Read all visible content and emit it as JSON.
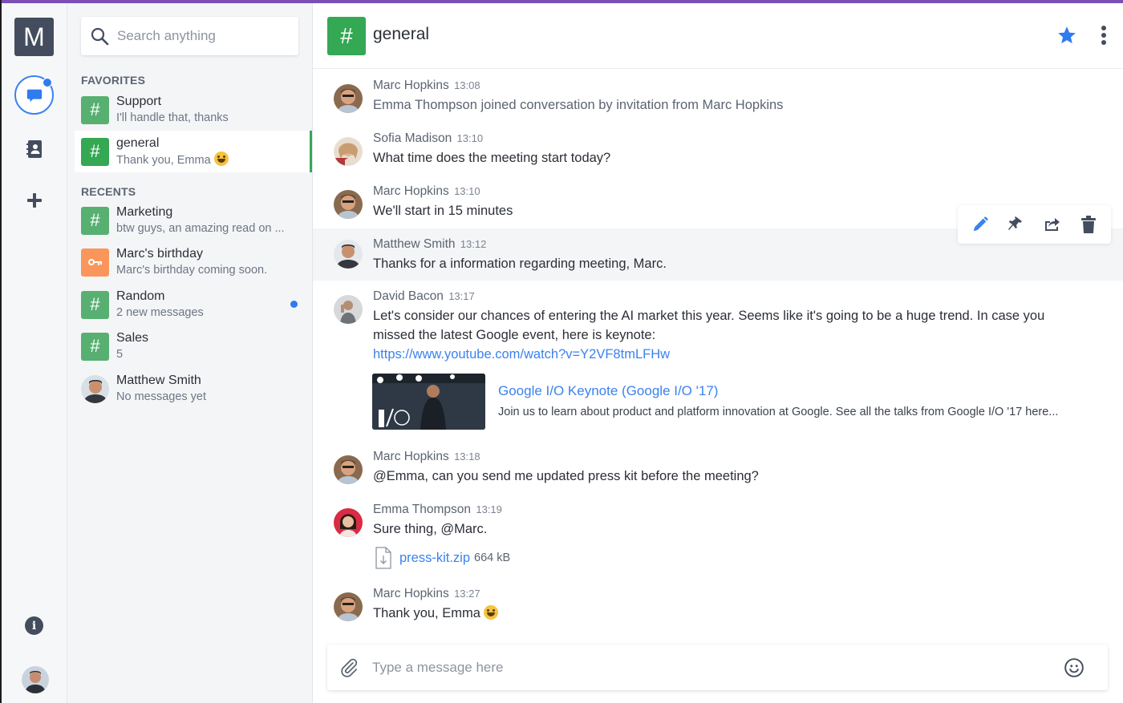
{
  "app": {
    "logo_letter": "M",
    "accent_color": "#3a82ef",
    "channel_color": "#34a853"
  },
  "rail": {
    "items": [
      {
        "name": "chats",
        "icon": "chat-bubble-icon",
        "has_notification": true
      },
      {
        "name": "contacts",
        "icon": "address-book-icon"
      },
      {
        "name": "new",
        "icon": "plus-icon"
      },
      {
        "name": "info",
        "icon": "info-icon",
        "glyph": "i"
      },
      {
        "name": "profile",
        "icon": "user-avatar"
      }
    ]
  },
  "sidebar": {
    "search_placeholder": "Search anything",
    "favorites_label": "FAVORITES",
    "recents_label": "RECENTS",
    "favorites": [
      {
        "name": "Support",
        "preview": "I'll handle that, thanks",
        "icon": "#"
      },
      {
        "name": "general",
        "preview": "Thank you, Emma",
        "icon": "#",
        "active": true,
        "emoji": "smile"
      }
    ],
    "recents": [
      {
        "name": "Marketing",
        "preview": "btw guys, an amazing read on ...",
        "icon": "#"
      },
      {
        "name": "Marc's birthday",
        "preview": "Marc's birthday coming soon.",
        "icon": "key"
      },
      {
        "name": "Random",
        "preview": "2 new messages",
        "icon": "#",
        "unread": true
      },
      {
        "name": "Sales",
        "preview": "5",
        "icon": "#"
      },
      {
        "name": "Matthew Smith",
        "preview": "No messages yet",
        "icon": "avatar"
      }
    ]
  },
  "header": {
    "icon": "#",
    "title": "general",
    "starred": true
  },
  "messages": [
    {
      "author": "Marc Hopkins",
      "time": "13:08",
      "text": "Emma Thompson joined conversation by invitation from Marc Hopkins",
      "system": true
    },
    {
      "author": "Sofia Madison",
      "time": "13:10",
      "text": "What time does the meeting start today?"
    },
    {
      "author": "Marc Hopkins",
      "time": "13:10",
      "text": "We'll start in 15 minutes"
    },
    {
      "author": "Matthew Smith",
      "time": "13:12",
      "text": "Thanks for a information regarding meeting, Marc.",
      "hovered": true
    },
    {
      "author": "David Bacon",
      "time": "13:17",
      "text_line1": "Let's consider our chances of entering the AI market this year. Seems like it's going to be a huge trend. In case you",
      "text_line2": "missed the latest Google event, here is keynote:",
      "link": "https://www.youtube.com/watch?v=Y2VF8tmLFHw",
      "preview": {
        "title": "Google I/O Keynote (Google I/O '17)",
        "description": "Join us to learn about product and platform innovation at Google. See all the talks from Google I/O '17 here..."
      }
    },
    {
      "author": "Marc Hopkins",
      "time": "13:18",
      "text": "@Emma, can you send me updated press kit before the meeting?"
    },
    {
      "author": "Emma Thompson",
      "time": "13:19",
      "text": "Sure thing, @Marc.",
      "file": {
        "name": "press-kit.zip",
        "size": "664 kB"
      }
    },
    {
      "author": "Marc Hopkins",
      "time": "13:27",
      "text": "Thank you, Emma",
      "emoji": "smile"
    }
  ],
  "message_actions": [
    "edit",
    "pin",
    "forward",
    "delete"
  ],
  "composer": {
    "placeholder": "Type a message here"
  }
}
